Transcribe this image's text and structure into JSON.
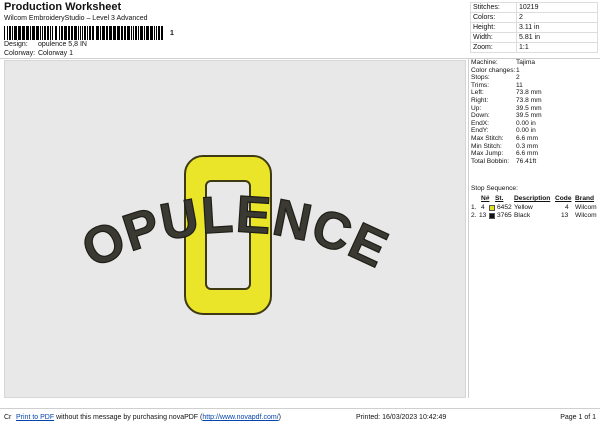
{
  "header": {
    "title": "Production Worksheet",
    "subtitle": "Wilcom EmbroideryStudio – Level 3 Advanced",
    "barcode_text": "1"
  },
  "meta": [
    {
      "key": "Design:",
      "value": "opulence 5,8 IN"
    },
    {
      "key": "Colorway:",
      "value": "Colorway 1"
    }
  ],
  "summary": [
    {
      "key": "Stitches:",
      "value": "10219"
    },
    {
      "key": "Colors:",
      "value": "2"
    },
    {
      "key": "Height:",
      "value": "3.11 in"
    },
    {
      "key": "Width:",
      "value": "5.81 in"
    },
    {
      "key": "Zoom:",
      "value": "1:1"
    }
  ],
  "properties": [
    {
      "key": "Machine:",
      "value": "Tajima"
    },
    {
      "key": "Color changes:",
      "value": "1"
    },
    {
      "key": "Stops:",
      "value": "2"
    },
    {
      "key": "Trims:",
      "value": "11"
    },
    {
      "key": "Left:",
      "value": "73.8 mm"
    },
    {
      "key": "Right:",
      "value": "73.8 mm"
    },
    {
      "key": "Up:",
      "value": "39.5 mm"
    },
    {
      "key": "Down:",
      "value": "39.5 mm"
    },
    {
      "key": "EndX:",
      "value": "0.00 in"
    },
    {
      "key": "EndY:",
      "value": "0.00 in"
    },
    {
      "key": "Max Stitch:",
      "value": "6.6 mm"
    },
    {
      "key": "Min Stitch:",
      "value": "0.3 mm"
    },
    {
      "key": "Max Jump:",
      "value": "6.6 mm"
    },
    {
      "key": "Total Bobbin:",
      "value": "76.41ft"
    }
  ],
  "stop_sequence": {
    "title": "Stop Sequence:",
    "columns": [
      "N#",
      "St.",
      "Description",
      "Code",
      "Brand"
    ],
    "rows": [
      {
        "index": "1.",
        "n": "4",
        "st": "6452",
        "description": "Yellow",
        "code": "4",
        "brand": "Wilcom",
        "color": "#e6e21c"
      },
      {
        "index": "2.",
        "n": "13",
        "st": "3765",
        "description": "Black",
        "code": "13",
        "brand": "Wilcom",
        "color": "#111111"
      }
    ]
  },
  "design": {
    "text": "OPULENCE",
    "big_letter": "O",
    "colors": {
      "yellow": "#ebe52a",
      "yellow_outline": "#3e3a14",
      "black": "#3a3a32",
      "background": "#e8e8e8"
    }
  },
  "footer": {
    "cr": "Cr",
    "link_text": "Print to PDF",
    "note": " without this message by purchasing novaPDF (",
    "url": "http://www.novapdf.com/",
    "note_end": ")",
    "printed": "Printed: 16/03/2023 10:42:49",
    "page": "Page 1 of 1"
  }
}
